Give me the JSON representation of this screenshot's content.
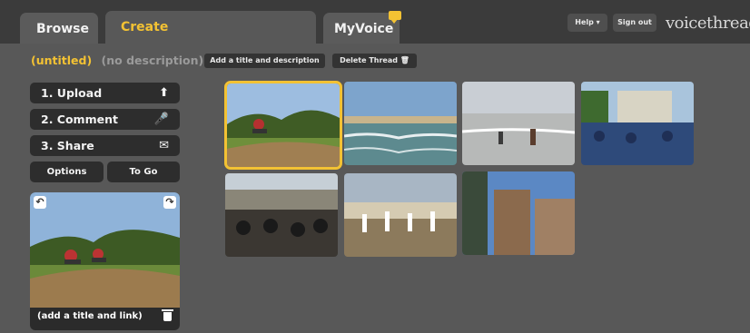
{
  "tabs": {
    "browse": "Browse",
    "create": "Create",
    "myvoice": "MyVoice"
  },
  "topbar": {
    "help_label": "Help ▾",
    "signout_label": "Sign out",
    "logo_text": "voicethread"
  },
  "thread": {
    "title": "(untitled)",
    "description": "(no description)",
    "add_title_label": "Add a title and description",
    "delete_label": "Delete Thread"
  },
  "steps": [
    {
      "label": "1. Upload",
      "icon": "upload-icon",
      "glyph": "⬆"
    },
    {
      "label": "2. Comment",
      "icon": "microphone-icon",
      "glyph": "🎤"
    },
    {
      "label": "3. Share",
      "icon": "envelope-icon",
      "glyph": "✉"
    }
  ],
  "options_label": "Options",
  "togo_label": "To Go",
  "preview": {
    "caption": "(add a title and link)"
  },
  "thumbnails": [
    {
      "name": "thumb-motocross",
      "selected": true
    },
    {
      "name": "thumb-beach-waves"
    },
    {
      "name": "thumb-beach-people"
    },
    {
      "name": "thumb-crowd-stage"
    },
    {
      "name": "thumb-band-crowd"
    },
    {
      "name": "thumb-marching-band"
    },
    {
      "name": "thumb-city-buildings"
    }
  ],
  "colors": {
    "accent": "#f3c233",
    "background": "#585858",
    "topbar": "#3b3b3b",
    "button": "#2d2d2d"
  }
}
